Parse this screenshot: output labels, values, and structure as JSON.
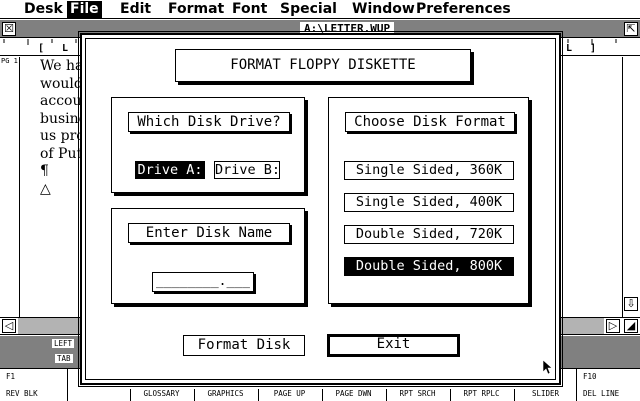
{
  "menubar": {
    "items": [
      "Desk",
      "File",
      "Edit",
      "Format",
      "Font",
      "Special",
      "Window",
      "Preferences"
    ],
    "active": "File"
  },
  "window": {
    "title": "A:\\LETTER.WUP",
    "close_glyph": "☒",
    "full_glyph": "⇱",
    "page_marker": "PG 1"
  },
  "document": {
    "lines": [
      "We ha",
      "would",
      "accou",
      "busine",
      "us pro",
      "of Put",
      "¶",
      "△"
    ]
  },
  "scroll": {
    "left_arrow": "◁",
    "right_arrow": "▷",
    "down_arrow": "⇩"
  },
  "dialog": {
    "title": "FORMAT FLOPPY DISKETTE",
    "drive_heading": "Which Disk Drive?",
    "drive_options": [
      {
        "label": "Drive A:",
        "selected": true
      },
      {
        "label": "Drive B:",
        "selected": false
      }
    ],
    "name_heading": "Enter Disk Name",
    "name_field": "________.___",
    "format_heading": "Choose Disk Format",
    "format_options": [
      {
        "label": "Single Sided, 360K",
        "selected": false
      },
      {
        "label": "Single Sided, 400K",
        "selected": false
      },
      {
        "label": "Double Sided, 720K",
        "selected": false
      },
      {
        "label": "Double Sided, 800K",
        "selected": true
      }
    ],
    "format_button": "Format Disk",
    "exit_button": "Exit"
  },
  "statusbar": {
    "left_label": "LEFT",
    "tab_label": "TAB",
    "f1_key": "F1",
    "f1_label": "REV BLK",
    "f10_key": "F10",
    "f10_label": "DEL LINE",
    "keys": [
      "GLOSSARY",
      "GRAPHICS",
      "PAGE UP",
      "PAGE DWN",
      "RPT SRCH",
      "RPT RPLC",
      "SLIDER"
    ]
  },
  "colors": {
    "foreground": "#000000",
    "background": "#ffffff"
  }
}
